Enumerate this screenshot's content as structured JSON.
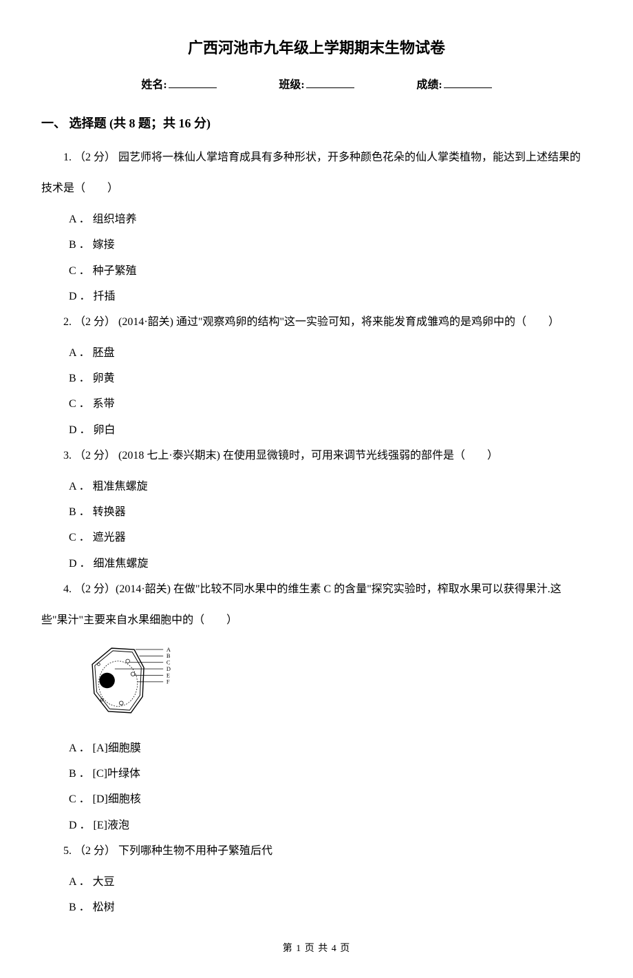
{
  "title": "广西河池市九年级上学期期末生物试卷",
  "header": {
    "name_label": "姓名:",
    "class_label": "班级:",
    "score_label": "成绩:"
  },
  "section1": {
    "title": "一、 选择题 (共 8 题；共 16 分)"
  },
  "q1": {
    "stem_line1": "1. （2 分） 园艺师将一株仙人掌培育成具有多种形状，开多种颜色花朵的仙人掌类植物，能达到上述结果的",
    "stem_line2": "技术是（　　）",
    "optA": "A ． 组织培养",
    "optB": "B ． 嫁接",
    "optC": "C ． 种子繁殖",
    "optD": "D ． 扦插"
  },
  "q2": {
    "stem": "2. （2 分） (2014·韶关) 通过\"观察鸡卵的结构\"这一实验可知，将来能发育成雏鸡的是鸡卵中的（　　）",
    "optA": "A ． 胚盘",
    "optB": "B ． 卵黄",
    "optC": "C ． 系带",
    "optD": "D ． 卵白"
  },
  "q3": {
    "stem": "3. （2 分） (2018 七上·泰兴期末) 在使用显微镜时，可用来调节光线强弱的部件是（　　）",
    "optA": "A ． 粗准焦螺旋",
    "optB": "B ． 转换器",
    "optC": "C ． 遮光器",
    "optD": "D ． 细准焦螺旋"
  },
  "q4": {
    "stem_line1": "4. （2 分）(2014·韶关) 在做\"比较不同水果中的维生素 C 的含量\"探究实验时，榨取水果可以获得果汁.这",
    "stem_line2": "些\"果汁\"主要来自水果细胞中的（　　）",
    "labels": {
      "a": "A",
      "b": "B",
      "c": "C",
      "d": "D",
      "e": "E",
      "f": "F"
    },
    "optA": "A ． [A]细胞膜",
    "optB": "B ． [C]叶绿体",
    "optC": "C ． [D]细胞核",
    "optD": "D ． [E]液泡"
  },
  "q5": {
    "stem": "5. （2 分） 下列哪种生物不用种子繁殖后代",
    "optA": "A ． 大豆",
    "optB": "B ． 松树"
  },
  "footer": "第 1 页 共 4 页"
}
